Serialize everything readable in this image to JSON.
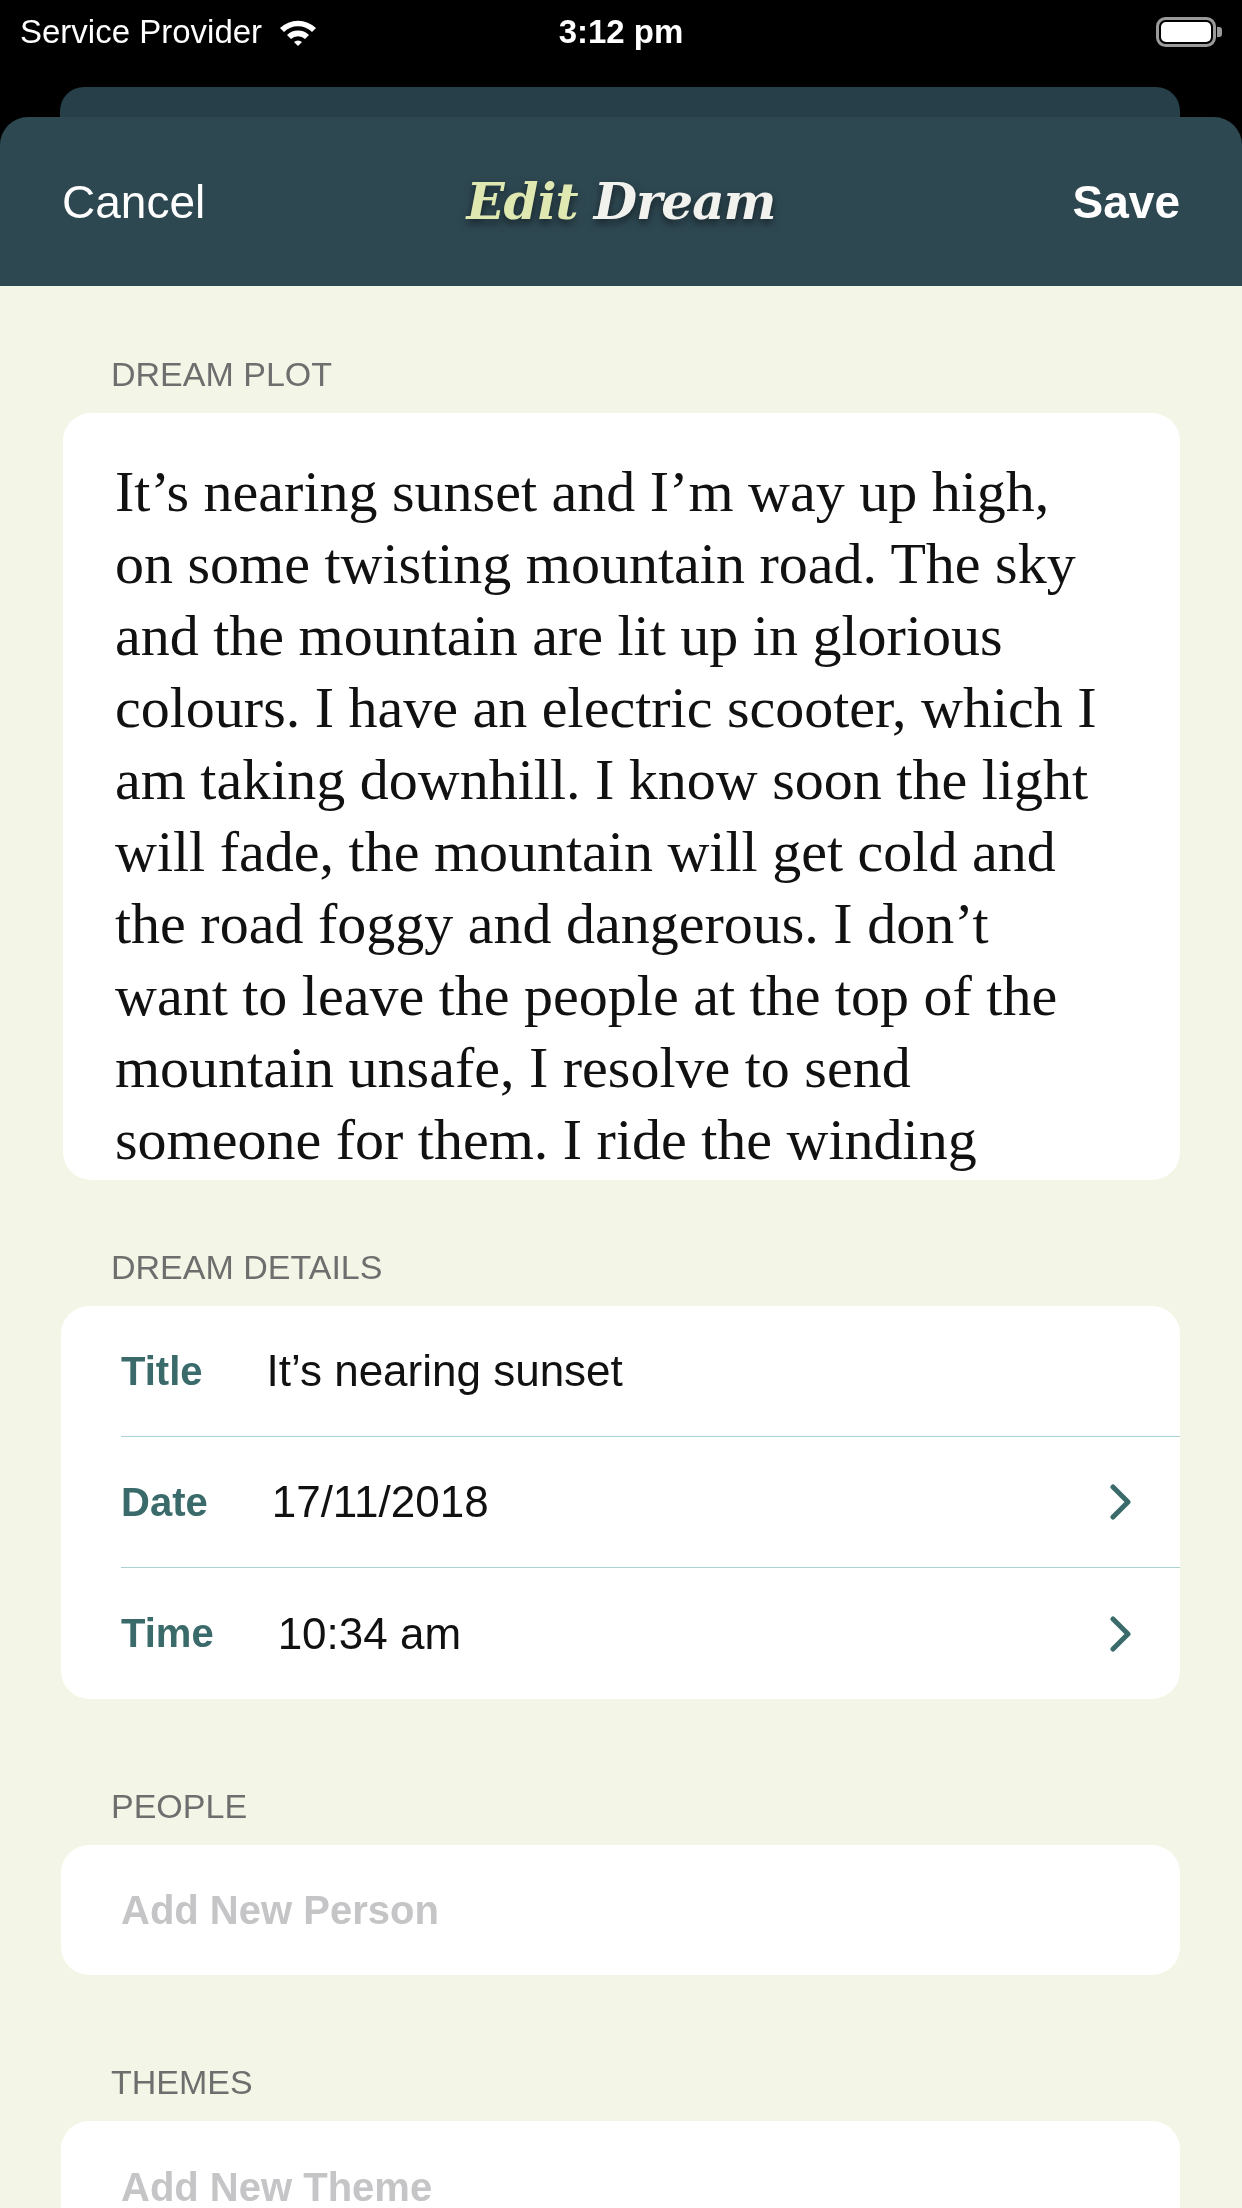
{
  "status_bar": {
    "carrier": "Service Provider",
    "time": "3:12 pm"
  },
  "nav_bar": {
    "cancel": "Cancel",
    "title": [
      {
        "text": "Edit",
        "color": "#dfe8b0"
      },
      {
        "text": "Dream",
        "color": "#f1f1ee"
      }
    ],
    "save": "Save"
  },
  "plot": {
    "label": "DREAM PLOT",
    "text": "It’s nearing sunset and I’m way up high, on some twisting mountain road. The sky and the mountain are lit up in glorious colours. I have an electric scooter, which I am taking downhill. I know soon the light will fade, the mountain will get cold and the road foggy and dangerous. I don’t want to leave the people at the top of the mountain unsafe, I resolve to send someone for them. I ride the winding"
  },
  "details": {
    "label": "DREAM DETAILS",
    "rows": [
      {
        "kind": "text",
        "label": "Title",
        "value": "It’s nearing sunset"
      },
      {
        "kind": "disclosure",
        "label": "Date",
        "value": "17/11/2018"
      },
      {
        "kind": "disclosure",
        "label": "Time",
        "value": "10:34 am"
      }
    ]
  },
  "people": {
    "label": "PEOPLE",
    "placeholder": "Add New Person"
  },
  "themes": {
    "label": "THEMES",
    "placeholder": "Add New Theme"
  }
}
